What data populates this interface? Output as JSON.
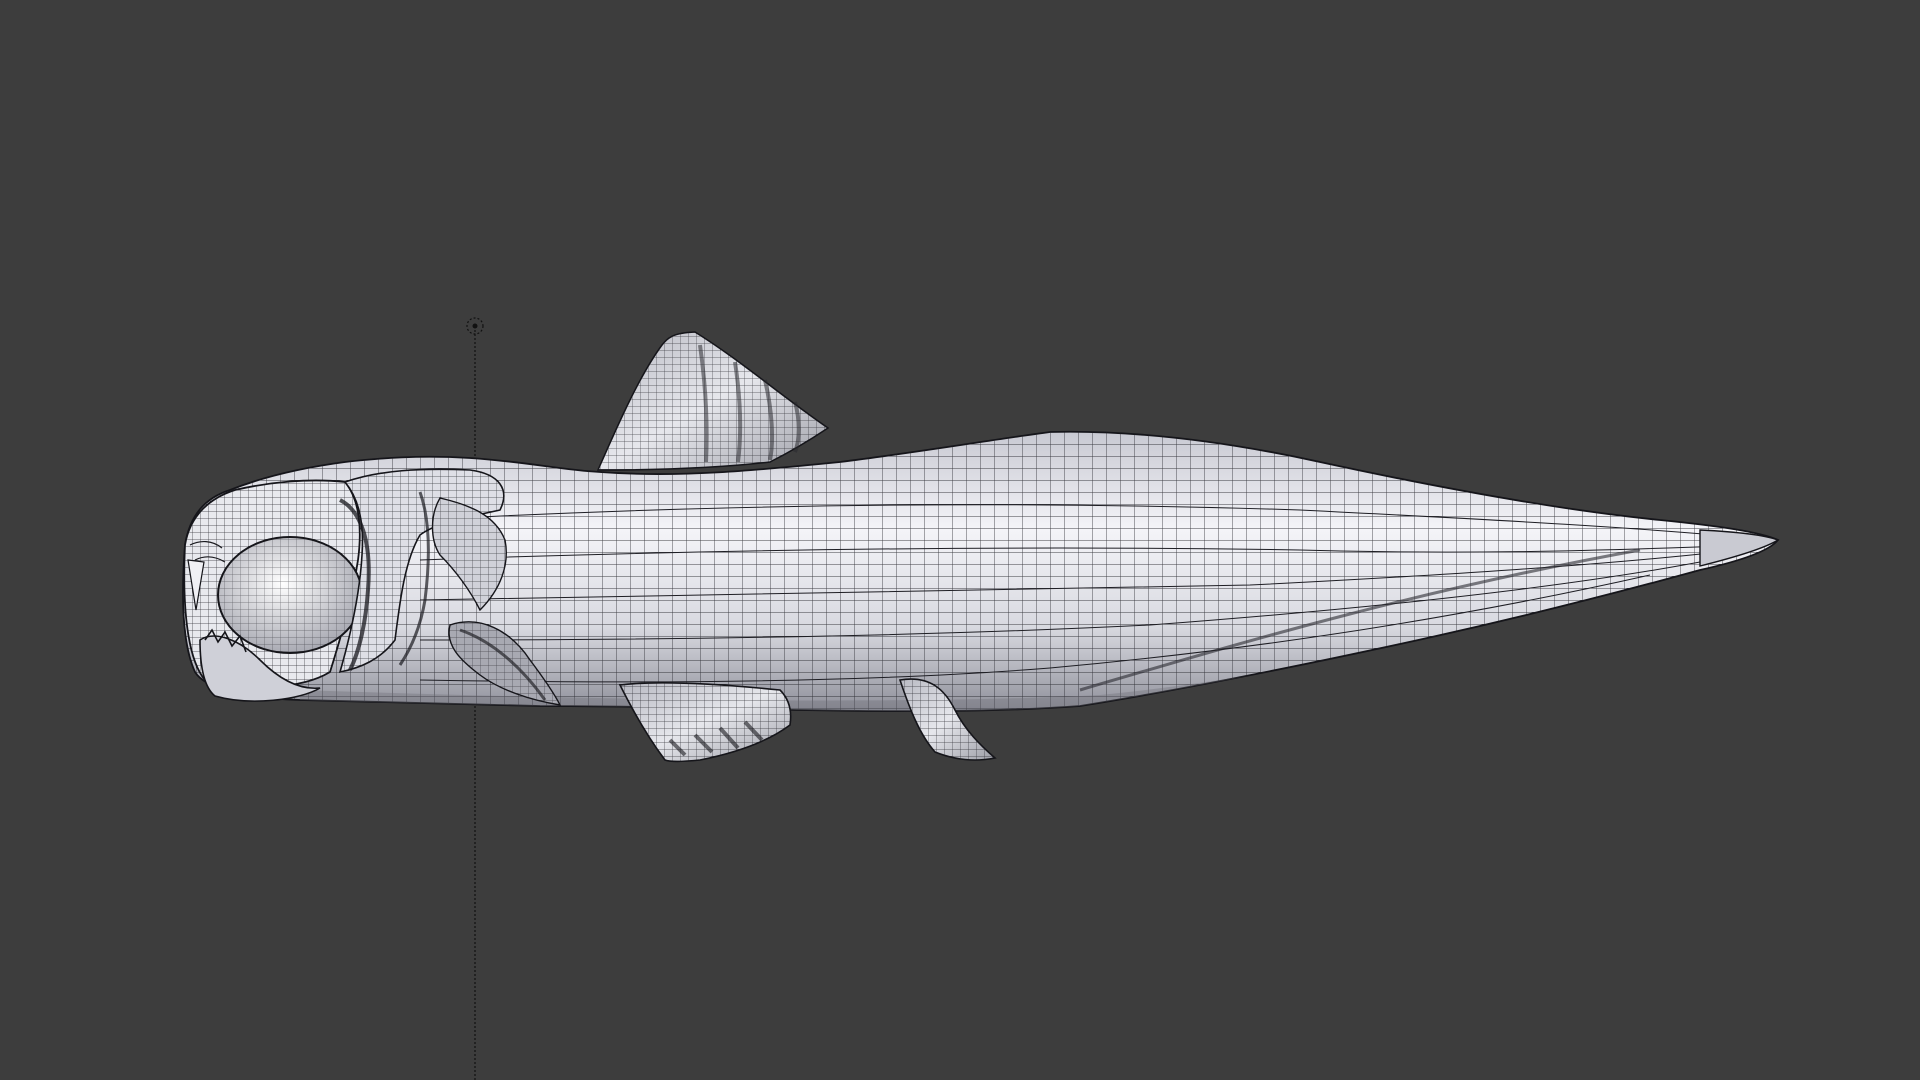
{
  "viewport": {
    "background_color": "#3d3d3d",
    "mesh_fill_color": "#dcdde3",
    "wire_color": "#1a1a1f",
    "object": "fish-mesh",
    "shading": "solid-with-wireframe-overlay"
  }
}
